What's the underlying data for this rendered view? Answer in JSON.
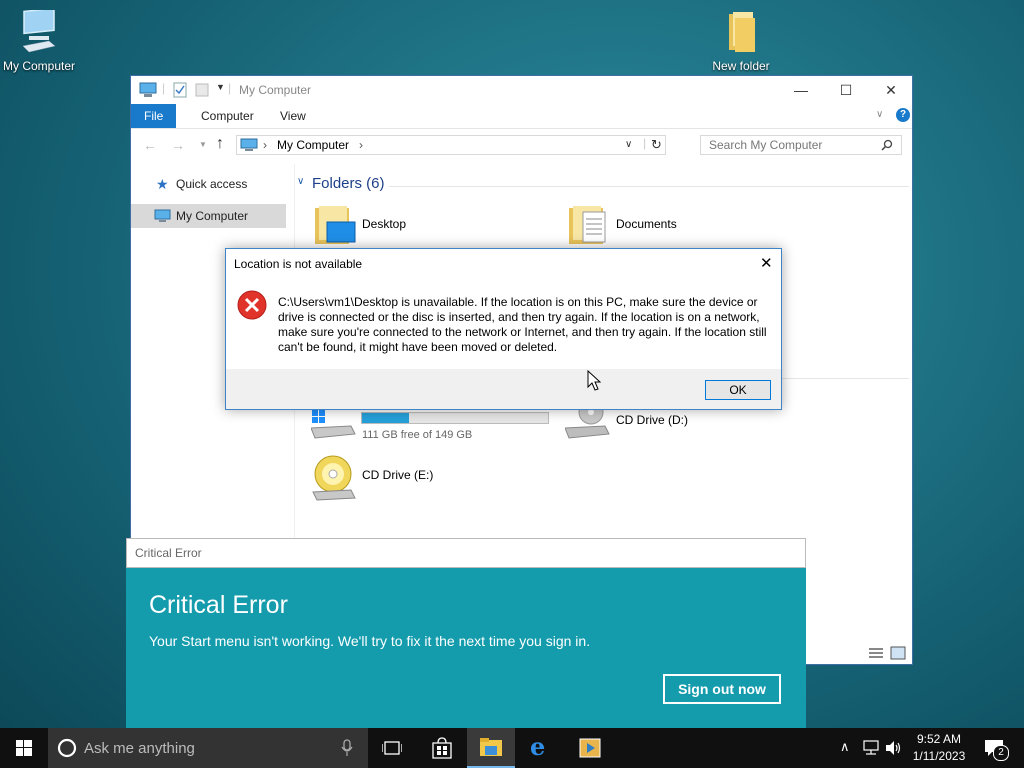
{
  "desktop": {
    "icons": [
      {
        "label": "My Computer"
      },
      {
        "label": "New folder"
      }
    ]
  },
  "explorer": {
    "title": "My Computer",
    "ribbon_tabs": [
      "File",
      "Computer",
      "View"
    ],
    "address_path": "My Computer",
    "search_placeholder": "Search My Computer",
    "nav": {
      "quick_access": "Quick access",
      "my_computer": "My Computer"
    },
    "folders_header": "Folders (6)",
    "folders": [
      "Desktop",
      "Documents"
    ],
    "drive_c_free": "111 GB free of 149 GB",
    "drive_c_used_fraction": 0.255,
    "cd_d": "CD Drive (D:)",
    "cd_e": "CD Drive (E:)"
  },
  "dialog": {
    "title": "Location is not available",
    "message": "C:\\Users\\vm1\\Desktop is unavailable. If the location is on this PC, make sure the device or drive is connected or the disc is inserted, and then try again. If the location is on a network, make sure you're connected to the network or Internet, and then try again. If the location still can't be found, it might have been moved or deleted.",
    "ok_label": "OK"
  },
  "critical": {
    "window_title": "Critical Error",
    "heading": "Critical Error",
    "message": "Your Start menu isn't working. We'll try to fix it the next time you sign in.",
    "button": "Sign out now"
  },
  "taskbar": {
    "search_placeholder": "Ask me anything",
    "time": "9:52 AM",
    "date": "1/11/2023",
    "notification_count": "2"
  },
  "colors": {
    "accent": "#1979ca",
    "critical_bg": "#149cad",
    "error_red": "#e0332a"
  }
}
